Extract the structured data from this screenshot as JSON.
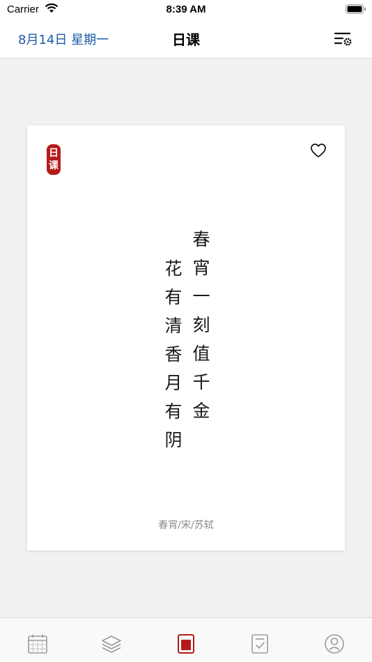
{
  "status_bar": {
    "carrier": "Carrier",
    "time": "8:39 AM",
    "wifi_icon": "wifi-icon",
    "battery_icon": "battery-icon"
  },
  "nav": {
    "date": "8月14日 星期一",
    "title": "日课",
    "settings_icon": "list-settings-icon",
    "accent_color": "#1e5aa8"
  },
  "card": {
    "seal_text": [
      "日",
      "课"
    ],
    "seal_color": "#b51a1a",
    "favorite_icon": "heart-icon",
    "poem_lines": [
      "春宵一刻值千金",
      "花有清香月有阴"
    ],
    "source": "春宵/宋/苏轼"
  },
  "tabs": [
    {
      "name": "calendar-icon"
    },
    {
      "name": "layers-icon"
    },
    {
      "name": "daily-card-icon",
      "active": true,
      "active_color": "#b51a1a"
    },
    {
      "name": "checklist-icon"
    },
    {
      "name": "profile-icon"
    }
  ]
}
